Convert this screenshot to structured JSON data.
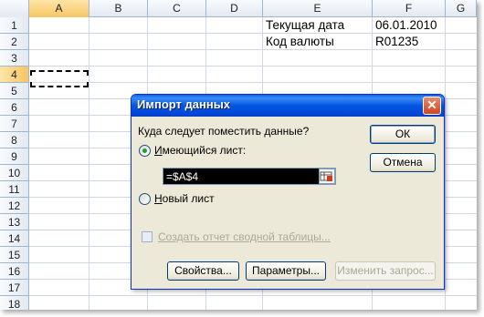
{
  "sheet": {
    "columns": [
      "A",
      "B",
      "C",
      "D",
      "E",
      "F",
      "G"
    ],
    "rows": [
      "1",
      "2",
      "3",
      "4",
      "5",
      "6",
      "7",
      "8",
      "9",
      "10",
      "11",
      "12",
      "13",
      "14",
      "15",
      "16",
      "17",
      "18"
    ],
    "active_column": "A",
    "active_row": "4",
    "cells": {
      "E1": "Текущая дата",
      "F1": "06.01.2010",
      "E2": "Код валюты",
      "F2": "R01235"
    }
  },
  "dialog": {
    "title": "Импорт данных",
    "close_label": "✕",
    "question": "Куда следует поместить данные?",
    "option_existing": "Имеющийся лист:",
    "reference_value": "=$A$4",
    "option_new": "Новый лист",
    "pivot_link": "Создать отчет сводной таблицы...",
    "ok_label": "ОК",
    "cancel_label": "Отмена",
    "properties_label": "Свойства...",
    "parameters_label": "Параметры...",
    "edit_query_label": "Изменить запрос...",
    "existing_checked": true,
    "new_checked": false
  },
  "colors": {
    "title_bar": "#0554e3",
    "dialog_bg": "#ece9d8",
    "radio_dot": "#21a121"
  }
}
